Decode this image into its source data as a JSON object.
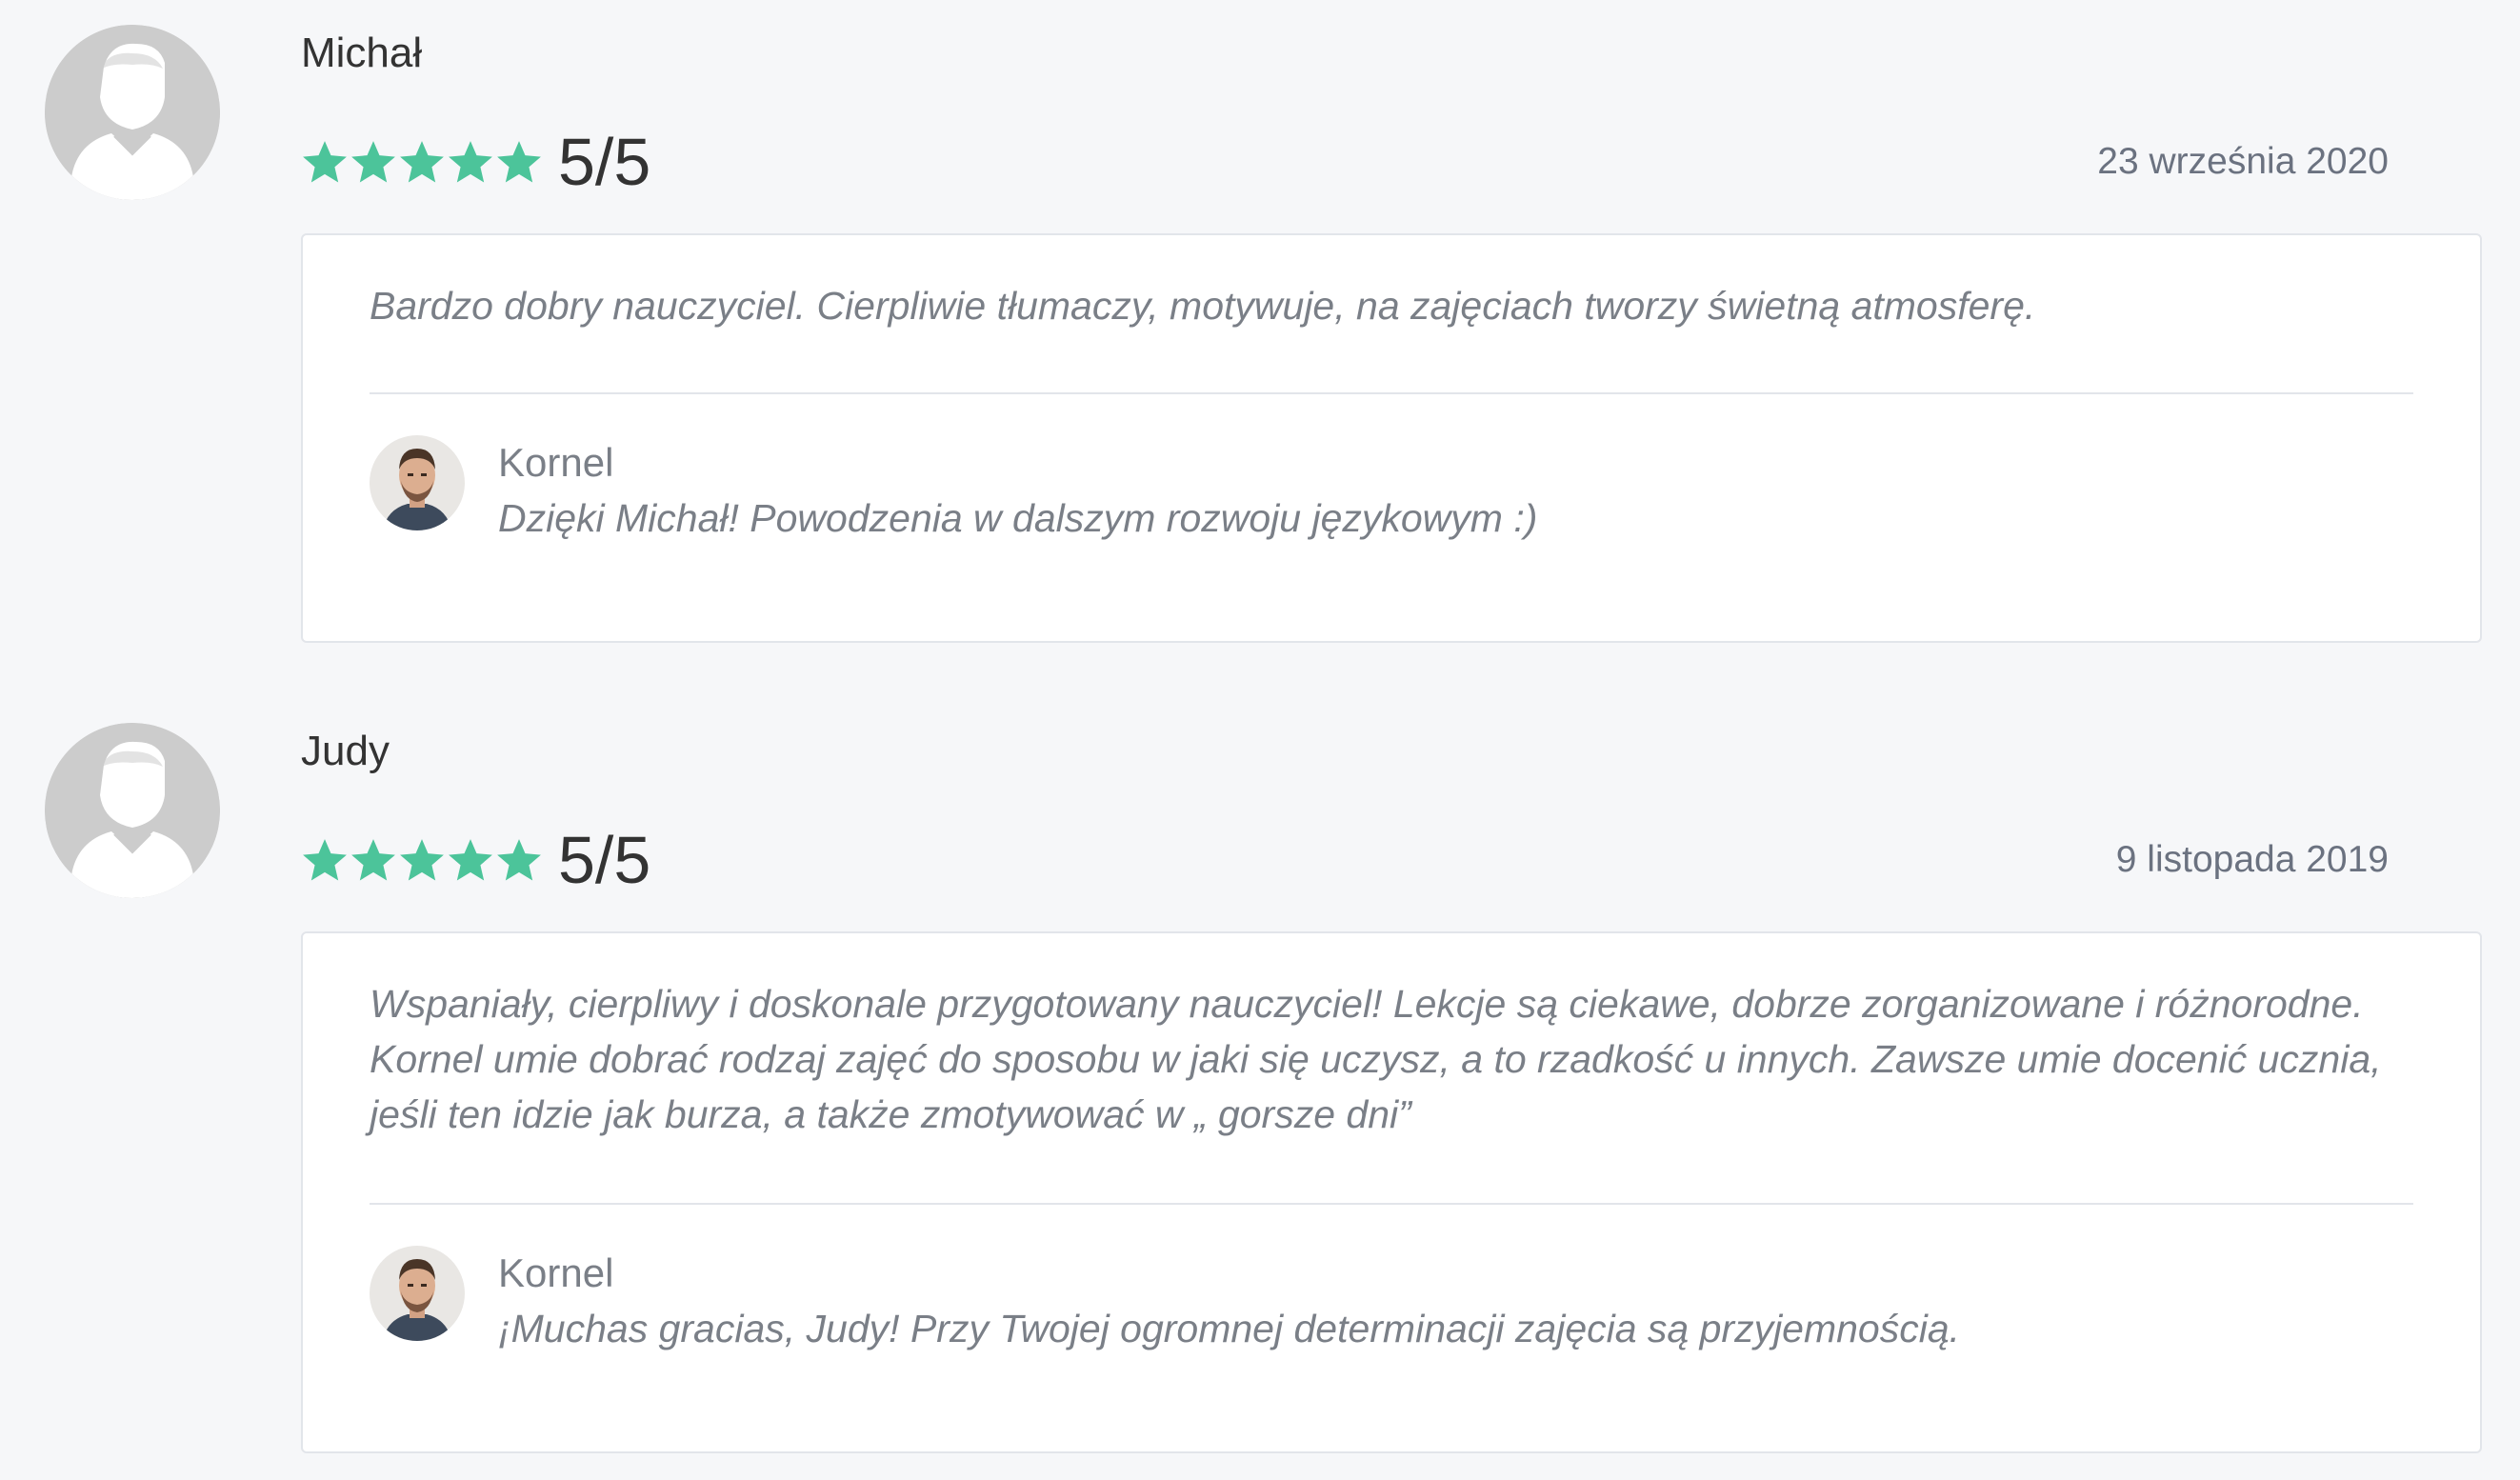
{
  "colors": {
    "background": "#f6f7f9",
    "star": "#4cc49a",
    "card_border": "#e2e5ea",
    "avatar_placeholder": "#cccccc"
  },
  "reviews": [
    {
      "reviewer": "Michał",
      "avatar_icon": "user-silhouette-icon",
      "stars": 5,
      "score": "5/5",
      "date": "23 września 2020",
      "text": [
        "Bardzo dobry nauczyciel. Cierpliwie tłumaczy, motywuje, na zajęciach tworzy świetną atmosferę."
      ],
      "reply": {
        "author": "Kornel",
        "text": "Dzięki Michał! Powodzenia w dalszym rozwoju językowym :)"
      }
    },
    {
      "reviewer": "Judy",
      "avatar_icon": "user-silhouette-icon",
      "stars": 5,
      "score": "5/5",
      "date": "9 listopada 2019",
      "text": [
        "Wspaniały, cierpliwy i doskonale przygotowany nauczyciel! Lekcje są ciekawe, dobrze zorganizowane i różnorodne.",
        "Kornel umie dobrać rodzaj zajęć do sposobu w jaki się uczysz, a to rzadkość u innych. Zawsze umie docenić ucznia,",
        "jeśli ten idzie jak burza, a także zmotywować w „ gorsze dni”"
      ],
      "reply": {
        "author": "Kornel",
        "text": "¡Muchas gracias, Judy! Przy Twojej ogromnej determinacji zajęcia są przyjemnością."
      }
    }
  ]
}
